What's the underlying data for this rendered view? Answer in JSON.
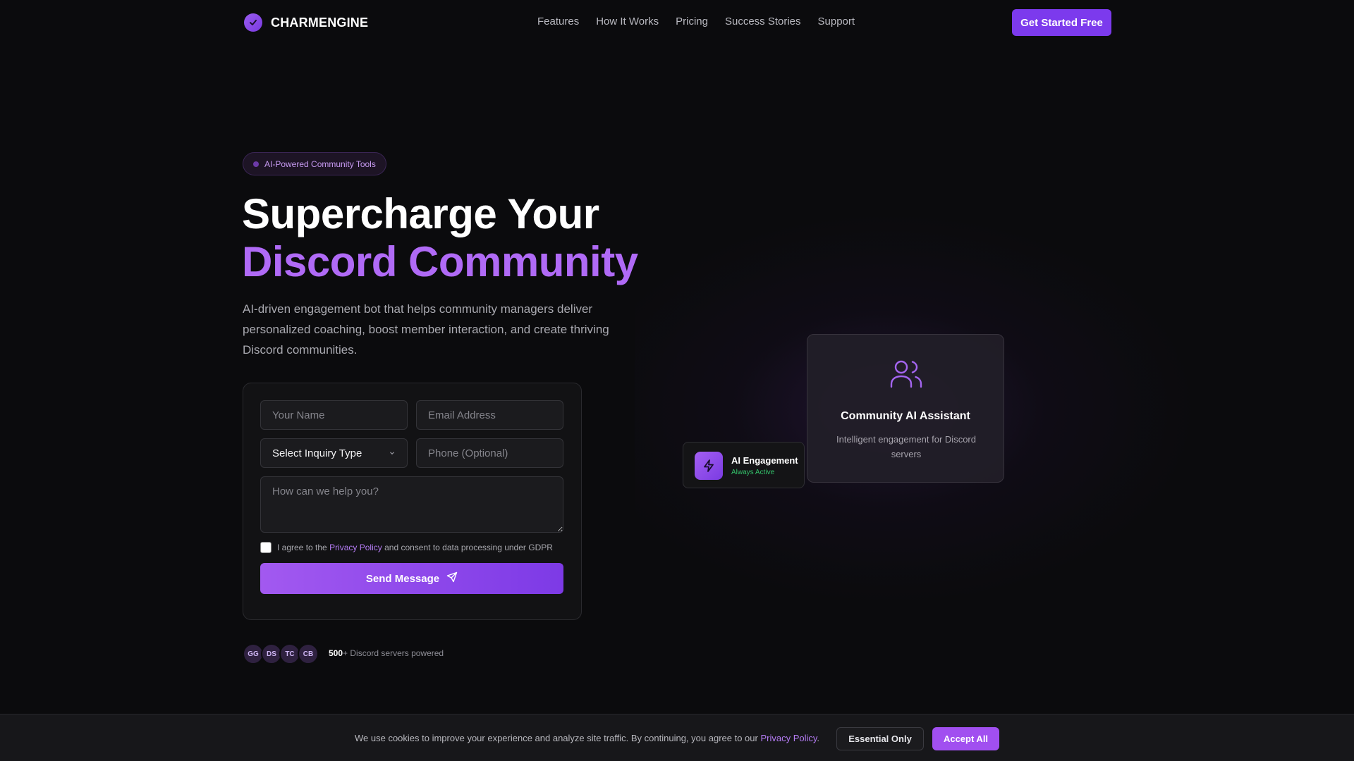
{
  "brand": {
    "name": "CHARMENGINE",
    "icon": "check-circle-icon"
  },
  "nav": {
    "links": [
      "Features",
      "How It Works",
      "Pricing",
      "Success Stories",
      "Support"
    ],
    "cta_label": "Get Started Free"
  },
  "hero": {
    "badge": "AI-Powered Community Tools",
    "title_line1": "Supercharge Your",
    "title_line2": "Discord Community",
    "description": "AI-driven engagement bot that helps community managers deliver personalized coaching, boost member interaction, and create thriving Discord communities."
  },
  "form": {
    "name_placeholder": "Your Name",
    "email_placeholder": "Email Address",
    "inquiry_selected": "Select Inquiry Type",
    "phone_placeholder": "Phone (Optional)",
    "message_placeholder": "How can we help you?",
    "consent_prefix": "I agree to the",
    "consent_link": "Privacy Policy",
    "consent_suffix": "and consent to data processing under GDPR",
    "consent_checked": false,
    "submit_label": "Send Message"
  },
  "social_proof": {
    "avatars": [
      "GG",
      "DS",
      "TC",
      "CB"
    ],
    "count": "500",
    "count_suffix": "+",
    "text": "Discord servers powered"
  },
  "assistant_card": {
    "icon": "users-icon",
    "title": "Community AI Assistant",
    "subtitle": "Intelligent engagement for Discord servers"
  },
  "engagement_card": {
    "icon": "lightning-icon",
    "title": "AI Engagement",
    "status": "Always Active"
  },
  "cookie": {
    "text": "We use cookies to improve your experience and analyze site traffic. By continuing, you agree to our",
    "link": "Privacy Policy",
    "link_suffix": ".",
    "essential_label": "Essential Only",
    "accept_label": "Accept All"
  },
  "colors": {
    "accent": "#7c3aed",
    "accent_light": "#b06af6",
    "status_green": "#33c36a",
    "background": "#0b0b0d"
  }
}
